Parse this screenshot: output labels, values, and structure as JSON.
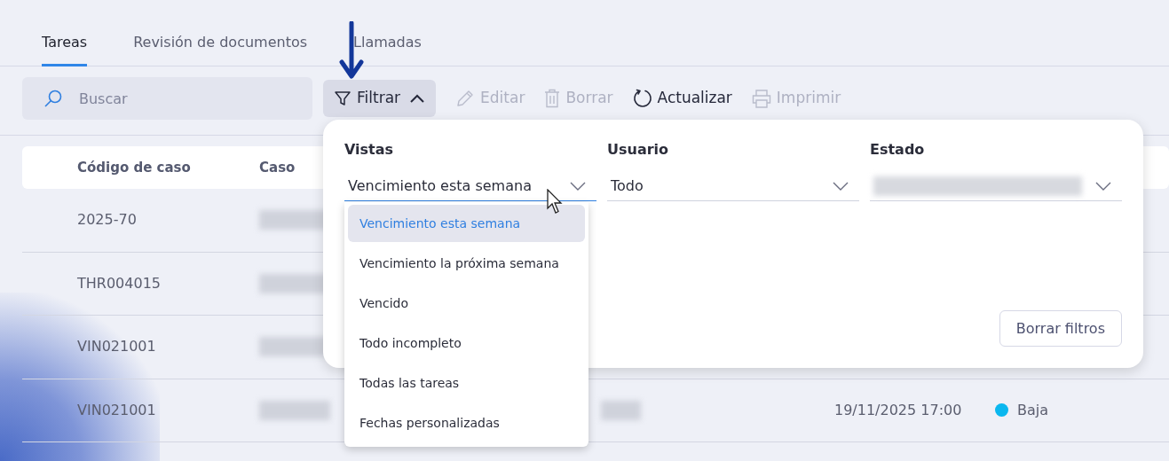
{
  "tabs": [
    {
      "label": "Tareas",
      "selected": true
    },
    {
      "label": "Revisión de documentos",
      "selected": false
    },
    {
      "label": "Llamadas",
      "selected": false
    }
  ],
  "toolbar": {
    "search": {
      "placeholder": "Buscar"
    },
    "buttons": [
      {
        "label": "Filtrar",
        "kind": "filter",
        "disabled": false,
        "expanded": true
      },
      {
        "label": "Editar",
        "kind": "edit",
        "disabled": true
      },
      {
        "label": "Borrar",
        "kind": "delete",
        "disabled": true
      },
      {
        "label": "Actualizar",
        "kind": "refresh",
        "disabled": false
      },
      {
        "label": "Imprimir",
        "kind": "print",
        "disabled": true
      }
    ]
  },
  "table": {
    "columns": [
      "Código de caso",
      "Caso"
    ],
    "rows": [
      {
        "code": "2025-70"
      },
      {
        "code": "THR004015"
      },
      {
        "code": "VIN021001"
      },
      {
        "code": "VIN021001",
        "due": "19/11/2025 17:00",
        "priority": "Baja",
        "color": "#0ab7ef"
      }
    ]
  },
  "filter_panel": {
    "fields": [
      {
        "label": "Vistas",
        "value": "Vencimiento esta semana",
        "focused": true
      },
      {
        "label": "Usuario",
        "value": "Todo",
        "focused": false
      },
      {
        "label": "Estado",
        "focused": false
      }
    ],
    "clear_button": "Borrar filtros",
    "options": [
      {
        "label": "Vencimiento esta semana",
        "selected": true
      },
      {
        "label": "Vencimiento la próxima semana",
        "selected": false
      },
      {
        "label": "Vencido",
        "selected": false
      },
      {
        "label": "Todo incompleto",
        "selected": false
      },
      {
        "label": "Todas las tareas",
        "selected": false
      },
      {
        "label": "Fechas personalizadas",
        "selected": false
      }
    ]
  }
}
